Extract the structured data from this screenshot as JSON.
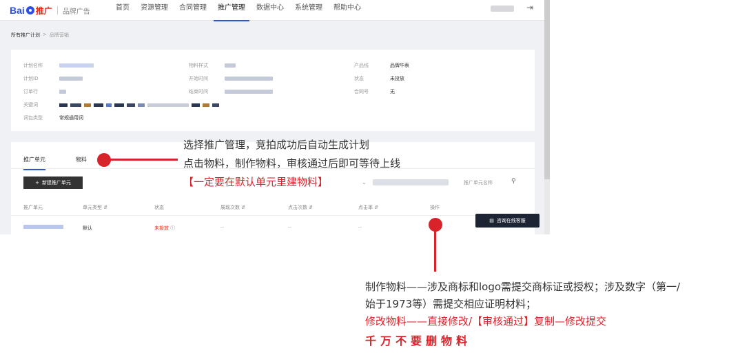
{
  "topbar": {
    "logo_bai": "Bai",
    "logo_tuiguang": "推广",
    "logo_brand": "品牌广告",
    "nav": [
      "首页",
      "资源管理",
      "合同管理",
      "推广管理",
      "数据中心",
      "系统管理",
      "帮助中心"
    ],
    "active_nav": "推广管理",
    "logout_icon": "logout-icon"
  },
  "breadcrumb": {
    "root": "所有推广计划",
    "sep": ">",
    "current": "品牌营销"
  },
  "plan_info": {
    "col1": [
      {
        "label": "计划名称"
      },
      {
        "label": "计划ID"
      },
      {
        "label": "订单行"
      },
      {
        "label": "关键词"
      },
      {
        "label": "词包类型",
        "value": "常规通用词"
      }
    ],
    "col2": [
      {
        "label": "物料样式"
      },
      {
        "label": "开始时间"
      },
      {
        "label": "结束时间"
      }
    ],
    "col3": [
      {
        "label": "产品线",
        "value": "品牌华表"
      },
      {
        "label": "状态",
        "value": "未投放"
      },
      {
        "label": "合同号",
        "value": "无"
      }
    ]
  },
  "units": {
    "tabs": [
      "推广单元",
      "物料"
    ],
    "new_button": "新建推广单元",
    "search_placeholder": "推广单元名称",
    "columns": [
      "推广单元",
      "单元类型 ⇵",
      "状态",
      "展现次数 ⇵",
      "点击次数 ⇵",
      "点击率 ⇵",
      "操作"
    ],
    "row": {
      "type": "默认",
      "status": "未投放",
      "impressions": "--",
      "clicks": "--",
      "ctr": "--"
    }
  },
  "chat_button": "咨询在线客服",
  "annotations": {
    "line1": "选择推广管理，竞拍成功后自动生成计划",
    "line2": "点击物料，制作物料，审核通过后即可等待上线",
    "line3": "【一定要在默认单元里建物料】",
    "bottom1": "制作物料——涉及商标和logo需提交商标证或授权；涉及数字（第一/",
    "bottom2": "始于1973等）需提交相应证明材料；",
    "bottom3": "修改物料——直接修改/【审核通过】复制—修改提交",
    "bottom4": "千万不要删物料"
  },
  "colors": {
    "accent": "#2d50e6",
    "annotation_red": "#d9232b"
  }
}
